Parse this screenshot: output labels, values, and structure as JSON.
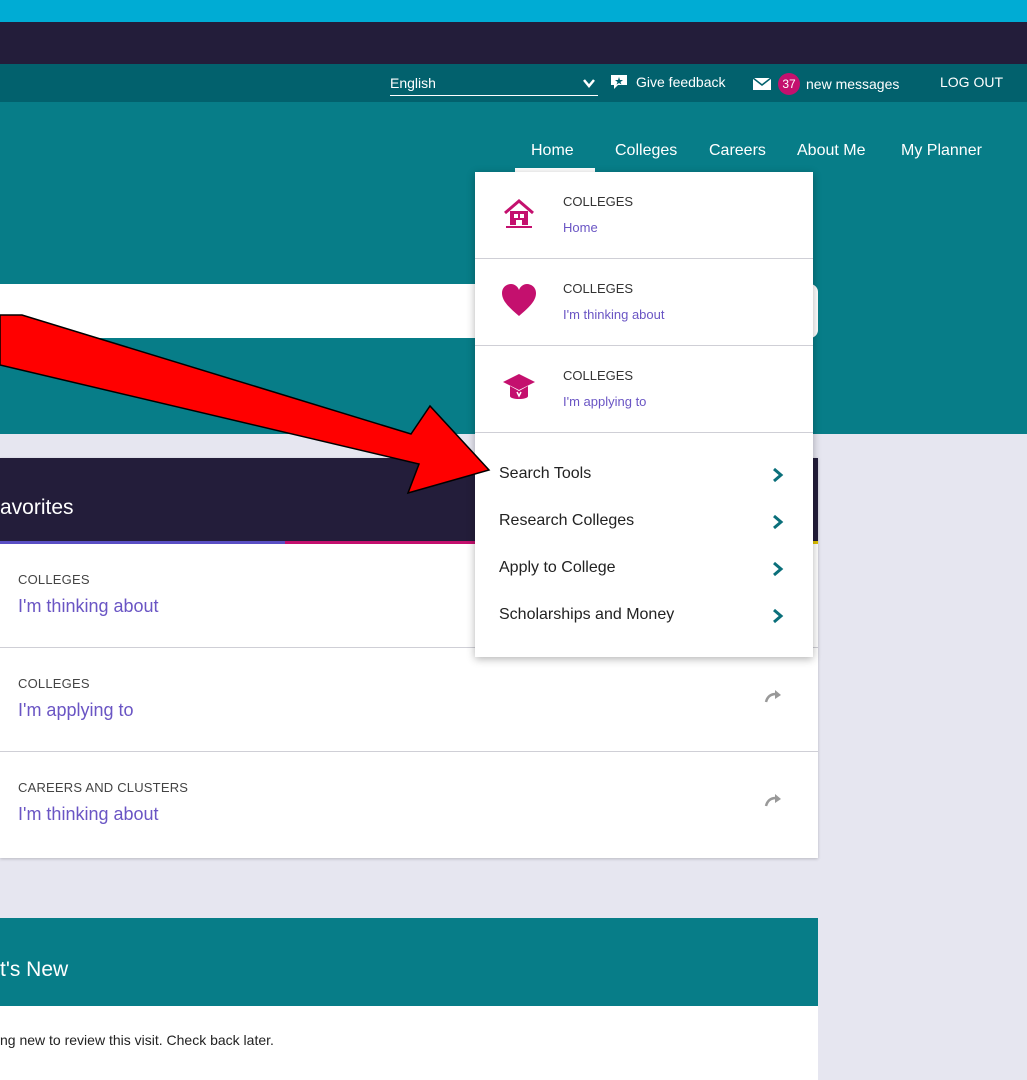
{
  "colors": {
    "top_strip": "#00acd4",
    "dark_bar": "#231d3a",
    "utility_bar": "#02616d",
    "teal": "#077d88",
    "accent_pink": "#c4106e",
    "link_purple": "#6a55c4",
    "annotation_red": "#ff0000"
  },
  "utility": {
    "language": "English",
    "feedback_label": "Give feedback",
    "message_count": "37",
    "messages_label": "new messages",
    "logout_label": "LOG OUT"
  },
  "nav": {
    "items": [
      {
        "label": "Home",
        "active": true
      },
      {
        "label": "Colleges"
      },
      {
        "label": "Careers"
      },
      {
        "label": "About Me"
      },
      {
        "label": "My Planner"
      }
    ]
  },
  "dropdown": {
    "favorites": [
      {
        "kicker": "COLLEGES",
        "sub": "Home",
        "icon": "house-icon"
      },
      {
        "kicker": "COLLEGES",
        "sub": "I'm thinking about",
        "icon": "heart-icon"
      },
      {
        "kicker": "COLLEGES",
        "sub": "I'm applying to",
        "icon": "graduation-cap-icon"
      }
    ],
    "links": [
      {
        "label": "Search Tools"
      },
      {
        "label": "Research Colleges"
      },
      {
        "label": "Apply to College"
      },
      {
        "label": "Scholarships and Money"
      }
    ]
  },
  "favorites_card": {
    "title": "avorites",
    "rows": [
      {
        "kicker": "COLLEGES",
        "link": "I'm thinking about"
      },
      {
        "kicker": "COLLEGES",
        "link": "I'm applying to"
      },
      {
        "kicker": "CAREERS AND CLUSTERS",
        "link": "I'm thinking about"
      }
    ]
  },
  "news_card": {
    "title": "t's New",
    "body": "ng new to review this visit. Check back later."
  }
}
